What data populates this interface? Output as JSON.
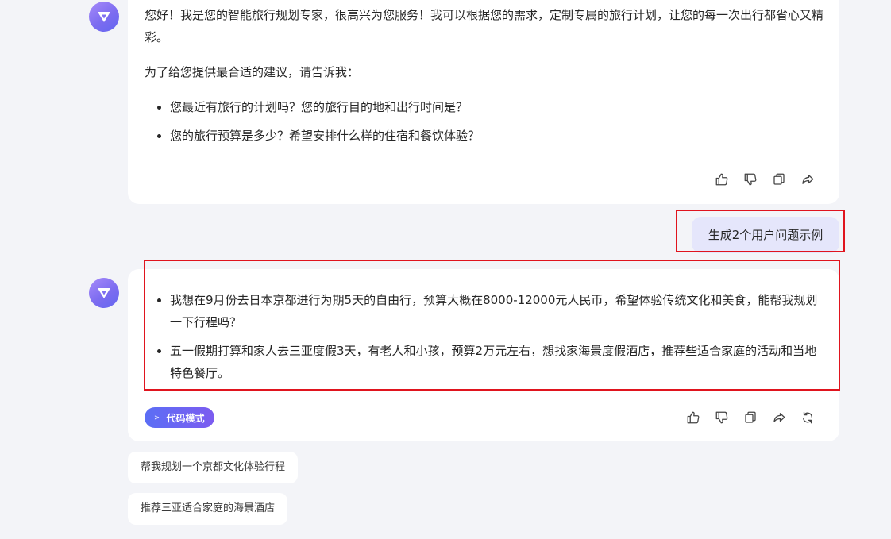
{
  "assistant_intro": {
    "paragraph_1": "您好！我是您的智能旅行规划专家，很高兴为您服务！我可以根据您的需求，定制专属的旅行计划，让您的每一次出行都省心又精彩。",
    "paragraph_2": "为了给您提供最合适的建议，请告诉我：",
    "bullets": [
      "您最近有旅行的计划吗？您的旅行目的地和出行时间是？",
      "您的旅行预算是多少？希望安排什么样的住宿和餐饮体验？"
    ]
  },
  "user_message": "生成2个用户问题示例",
  "assistant_reply": {
    "bullets": [
      "我想在9月份去日本京都进行为期5天的自由行，预算大概在8000-12000元人民币，希望体验传统文化和美食，能帮我规划一下行程吗？",
      "五一假期打算和家人去三亚度假3天，有老人和小孩，预算2万元左右，想找家海景度假酒店，推荐些适合家庭的活动和当地特色餐厅。"
    ]
  },
  "code_mode": {
    "glyph": ">_",
    "label": "代码模式"
  },
  "suggestions": [
    "帮我规划一个京都文化体验行程",
    "推荐三亚适合家庭的海景酒店"
  ],
  "icons": {
    "avatar": "assistant-logo-icon",
    "like": "thumbs-up-icon",
    "dislike": "thumbs-down-icon",
    "copy": "copy-icon",
    "share": "share-icon",
    "regenerate": "refresh-icon"
  },
  "colors": {
    "background": "#f3f4f8",
    "card": "#ffffff",
    "user_bubble": "#e5e6fb",
    "accent": "#6366f1",
    "highlight": "#e0141e"
  }
}
